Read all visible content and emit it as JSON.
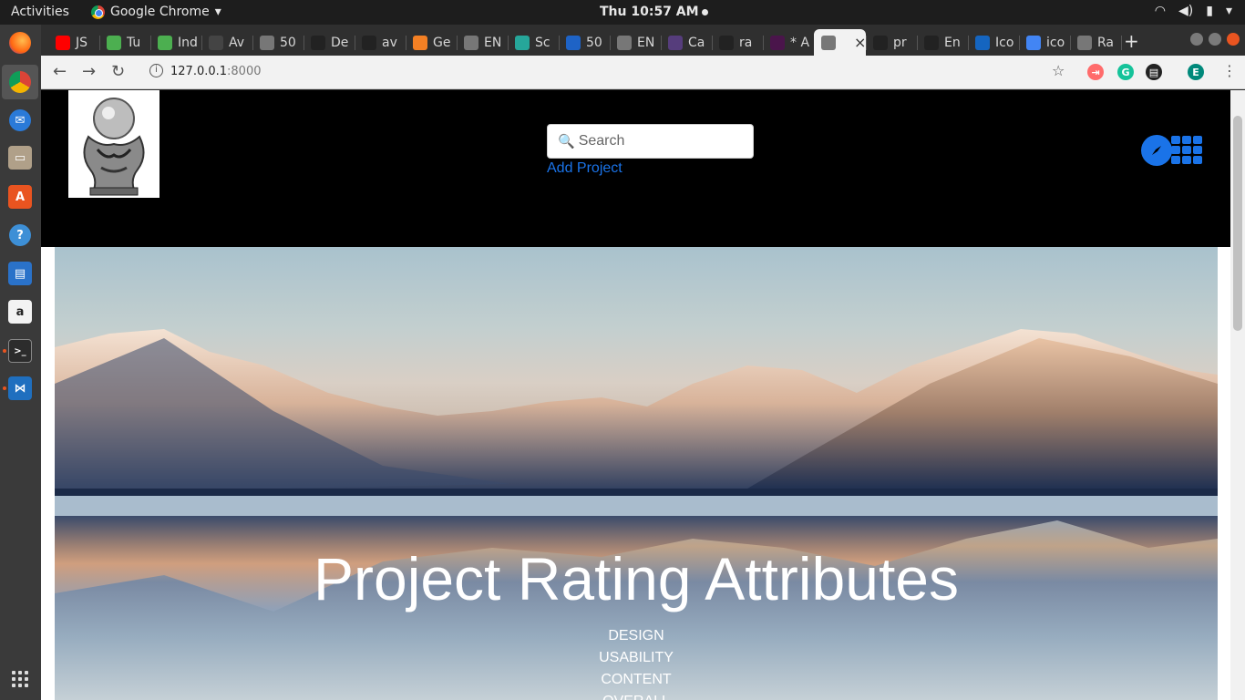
{
  "system": {
    "activities": "Activities",
    "app_name": "Google Chrome",
    "clock": "Thu 10:57 AM"
  },
  "tabs": [
    {
      "label": "JS",
      "icon": "youtube-icon",
      "color": "#ff0000"
    },
    {
      "label": "Tu",
      "icon": "leaf-icon",
      "color": "#4caf50"
    },
    {
      "label": "Ind",
      "icon": "leaf-icon",
      "color": "#4caf50"
    },
    {
      "label": "Av",
      "icon": "w-icon",
      "color": "#444444"
    },
    {
      "label": "50",
      "icon": "page-icon",
      "color": "#777777"
    },
    {
      "label": "De",
      "icon": "github-icon",
      "color": "#222222"
    },
    {
      "label": "av",
      "icon": "github-icon",
      "color": "#222222"
    },
    {
      "label": "Ge",
      "icon": "stackoverflow-icon",
      "color": "#f48024"
    },
    {
      "label": "EN",
      "icon": "page-icon",
      "color": "#777777"
    },
    {
      "label": "Sc",
      "icon": "d-icon",
      "color": "#26a69a"
    },
    {
      "label": "50",
      "icon": "fx-icon",
      "color": "#1e63c6"
    },
    {
      "label": "EN",
      "icon": "page-icon",
      "color": "#777777"
    },
    {
      "label": "Ca",
      "icon": "bootstrap-icon",
      "color": "#563d7c"
    },
    {
      "label": "ra",
      "icon": "github-icon",
      "color": "#222222"
    },
    {
      "label": "* A",
      "icon": "slack-icon",
      "color": "#4a154b"
    },
    {
      "label": "",
      "icon": "page-icon",
      "color": "#777777",
      "active": true
    },
    {
      "label": "pr",
      "icon": "github-icon",
      "color": "#222222"
    },
    {
      "label": "En",
      "icon": "github-icon",
      "color": "#222222"
    },
    {
      "label": "Ico",
      "icon": "flag-icon",
      "color": "#1565c0"
    },
    {
      "label": "ico",
      "icon": "google-icon",
      "color": "#4285f4"
    },
    {
      "label": "Ra",
      "icon": "page-icon",
      "color": "#777777"
    }
  ],
  "address_bar": {
    "host": "127.0.0.1",
    "port": ":8000"
  },
  "extensions": [
    {
      "name": "cast-icon",
      "color": "#ff6b6b",
      "glyph": "⇥"
    },
    {
      "name": "grammarly-icon",
      "color": "#15c39a",
      "glyph": "G"
    },
    {
      "name": "film-icon",
      "color": "#222222",
      "glyph": "▤"
    },
    {
      "name": "profile-avatar",
      "color": "#00897b",
      "glyph": "E"
    }
  ],
  "header": {
    "search_placeholder": "Search",
    "search_icon": "🔍",
    "add_project": "Add Project"
  },
  "hero": {
    "title": "Project Rating Attributes",
    "attributes": [
      "DESIGN",
      "USABILITY",
      "CONTENT",
      "OVERALL"
    ]
  },
  "colors": {
    "accent": "#1a73e8",
    "header_bg": "#000000",
    "dock_bg": "#3a3a3a"
  }
}
